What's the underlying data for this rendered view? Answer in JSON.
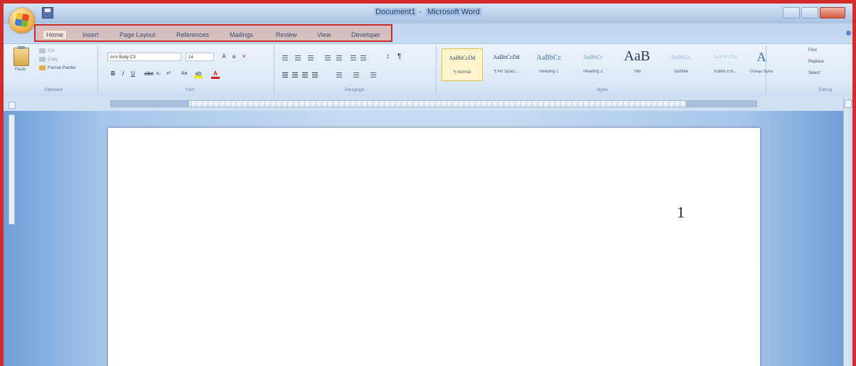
{
  "window": {
    "title_document": "Document1",
    "title_separator": " - ",
    "title_app": "Microsoft Word"
  },
  "tabs": [
    "Home",
    "Insert",
    "Page Layout",
    "References",
    "Mailings",
    "Review",
    "View",
    "Developer"
  ],
  "clipboard": {
    "paste_label": "Paste",
    "cut_label": "Cut",
    "copy_label": "Copy",
    "format_painter_label": "Format Painter",
    "group_label": "Clipboard"
  },
  "font": {
    "font_name": "ornr Body CS",
    "font_size": "14",
    "group_label": "Font"
  },
  "paragraph": {
    "group_label": "Paragraph"
  },
  "styles": {
    "items": [
      {
        "preview": "AaBbCcDd",
        "caption": "¶ Normal"
      },
      {
        "preview": "AaBbCcDd",
        "caption": "¶ No Spaci..."
      },
      {
        "preview": "AaBbCc",
        "caption": "Heading 1"
      },
      {
        "preview": "AaBbCc",
        "caption": "Heading 2"
      },
      {
        "preview": "AaB",
        "caption": "Title"
      },
      {
        "preview": "AaBbCc.",
        "caption": "Subtitle"
      },
      {
        "preview": "AaBbCcDd",
        "caption": "Subtle Em..."
      }
    ],
    "change_styles_label": "Change Styles",
    "group_label": "Styles"
  },
  "editing": {
    "find_label": "Find",
    "replace_label": "Replace",
    "select_label": "Select",
    "group_label": "Editing"
  },
  "document": {
    "page_number": "1"
  },
  "colors": {
    "highlight_border": "#c62a2a",
    "accent": "#3a6fb0"
  },
  "icons": {
    "office_button": "office-logo-icon",
    "save": "save-icon",
    "paste": "paste-icon",
    "find": "binoculars-icon"
  }
}
